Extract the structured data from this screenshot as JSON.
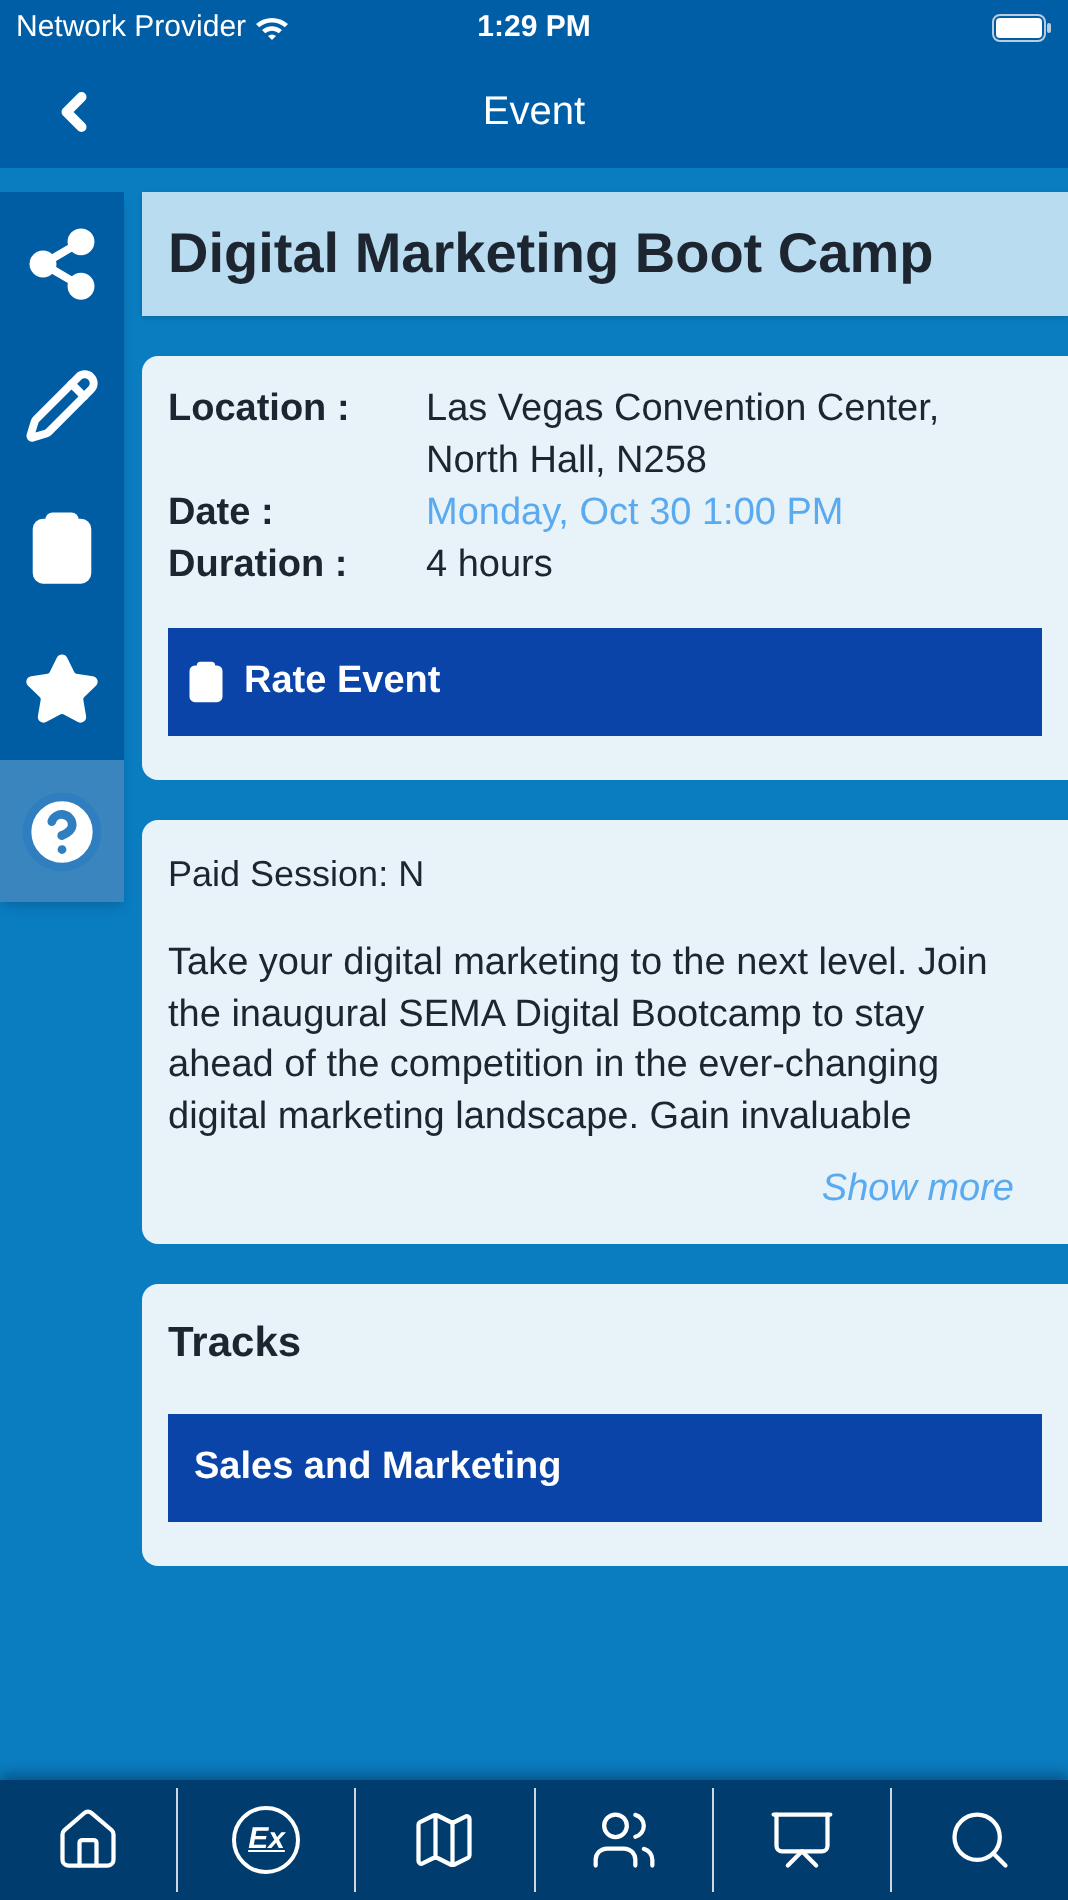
{
  "status_bar": {
    "carrier": "Network Provider",
    "time": "1:29 PM"
  },
  "nav": {
    "title": "Event"
  },
  "sidebar": {
    "items": [
      {
        "kind": "share",
        "selected": false
      },
      {
        "kind": "edit",
        "selected": false
      },
      {
        "kind": "clipboard",
        "selected": false
      },
      {
        "kind": "star",
        "selected": false
      },
      {
        "kind": "help",
        "selected": true
      }
    ]
  },
  "event": {
    "title": "Digital Marketing Boot Camp",
    "details": [
      {
        "label": "Location :",
        "value": "Las Vegas Convention Center, North Hall, N258",
        "kind": "text"
      },
      {
        "label": "Date :",
        "value": "Monday, Oct 30 1:00 PM",
        "kind": "link"
      },
      {
        "label": "Duration :",
        "value": "4 hours",
        "kind": "text"
      }
    ],
    "rate_button": "Rate Event"
  },
  "description": {
    "paid": "Paid Session: N",
    "text": "Take your digital marketing to the next level. Join the inaugural SEMA Digital Bootcamp to stay ahead of the competition in the ever-changing digital marketing landscape. Gain invaluable",
    "show_more": "Show more"
  },
  "tracks": {
    "heading": "Tracks",
    "items": [
      "Sales and Marketing"
    ]
  },
  "tab_bar": {
    "items": [
      {
        "kind": "home"
      },
      {
        "kind": "ex",
        "label": "Ex"
      },
      {
        "kind": "map"
      },
      {
        "kind": "meeting"
      },
      {
        "kind": "speaker"
      },
      {
        "kind": "search"
      }
    ]
  }
}
